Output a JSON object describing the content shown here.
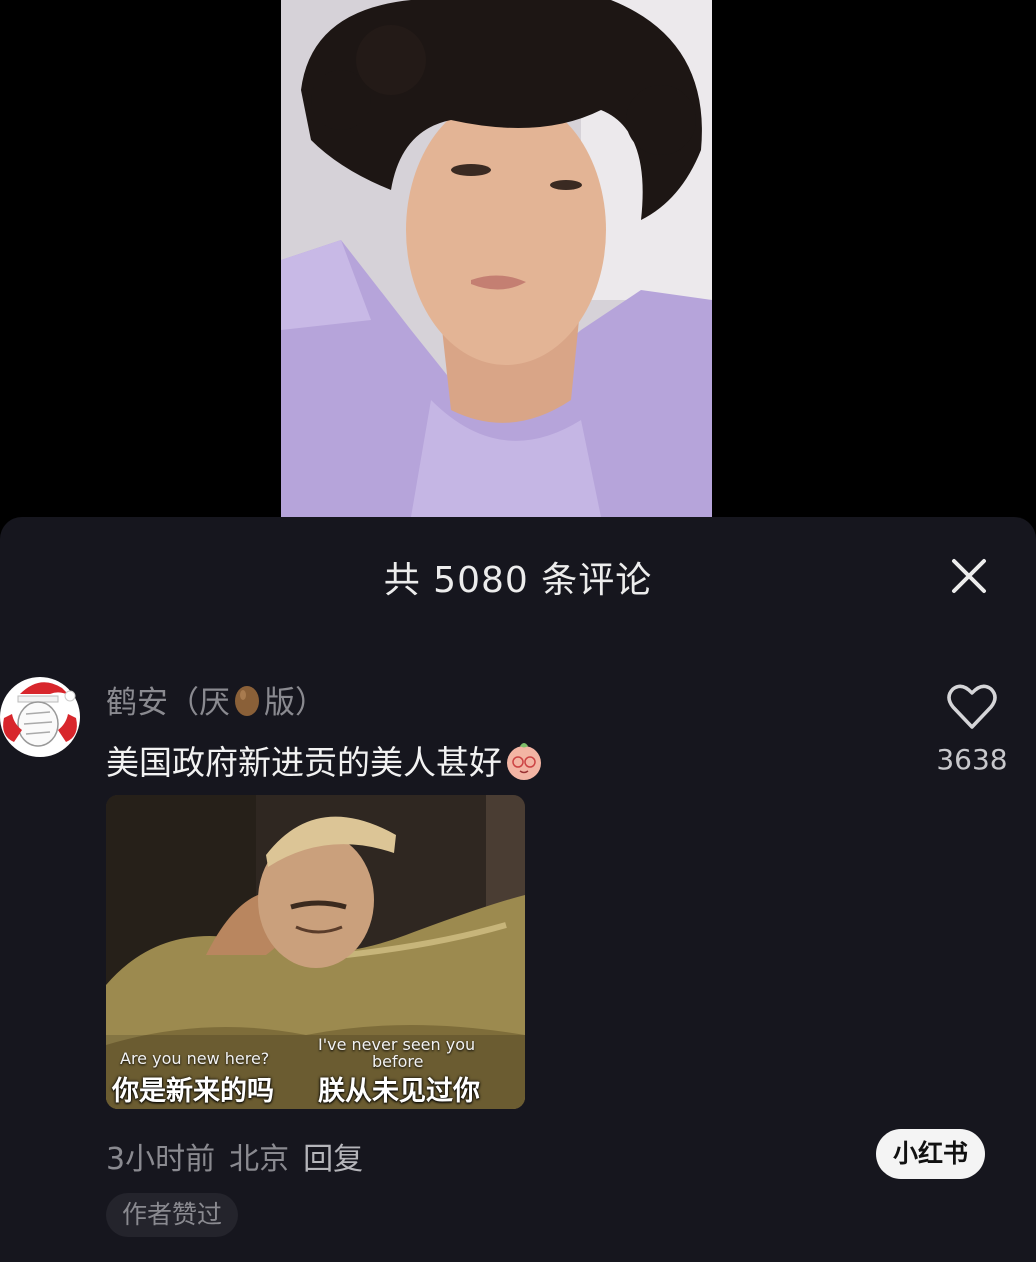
{
  "comments_panel": {
    "title": "共 5080 条评论",
    "close_icon": "close-icon"
  },
  "comment": {
    "username_before": "鹤安（厌",
    "username_after": "版）",
    "text": "美国政府新进贡的美人甚好",
    "like_count": "3638",
    "like_icon": "heart-outline-icon",
    "meme": {
      "left_caption_en": "Are you new here?",
      "left_caption_cn": "你是新来的吗",
      "right_caption_en_line1": "I've never seen you",
      "right_caption_en_line2": "before",
      "right_caption_cn": "朕从未见过你"
    },
    "time": "3小时前",
    "location": "北京",
    "reply_label": "回复",
    "author_badge": "作者赞过"
  },
  "watermark": "小红书",
  "colors": {
    "sheet_bg": "#16161e",
    "text_primary": "#f2f2f2",
    "text_secondary": "#8a8a90"
  }
}
